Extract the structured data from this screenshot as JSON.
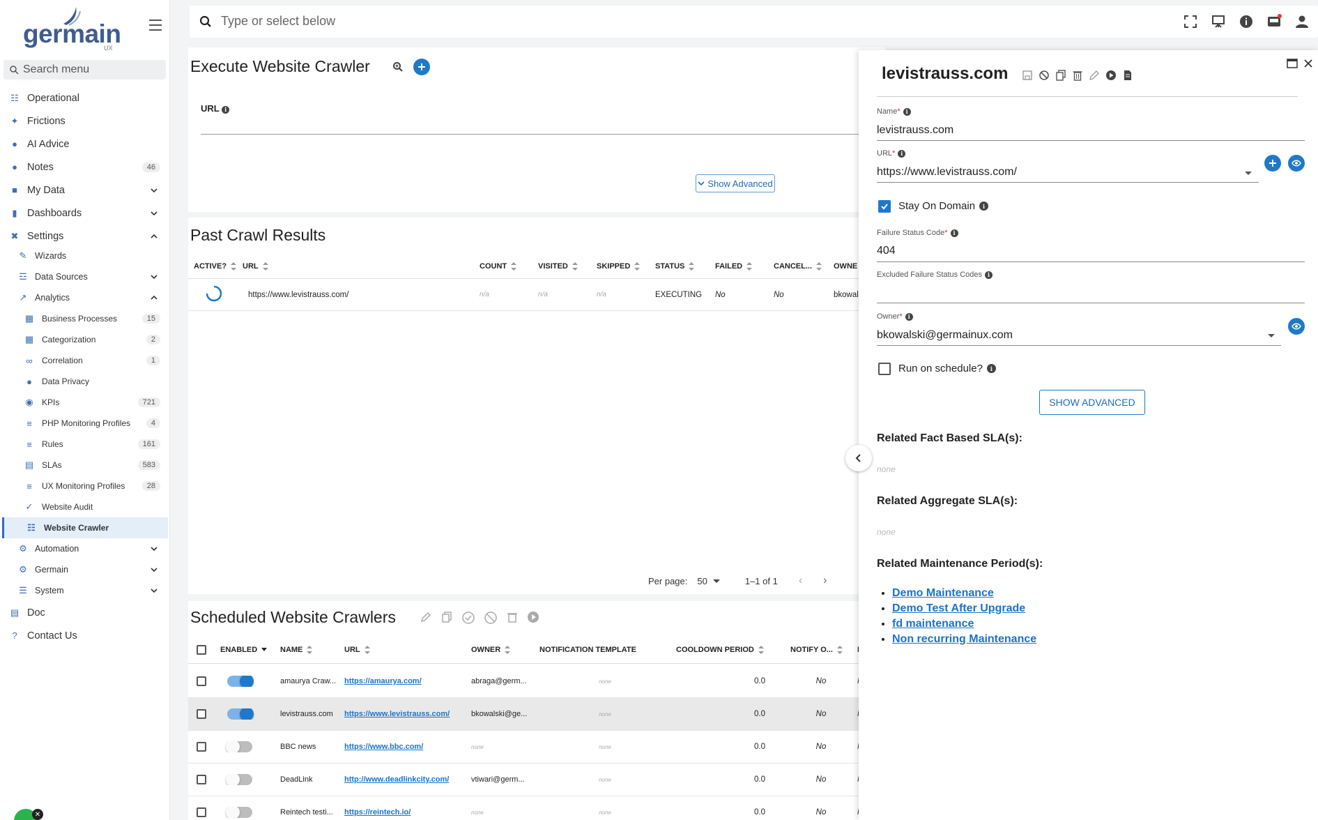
{
  "app": {
    "logo_text": "germain",
    "logo_sub": "UX"
  },
  "sidebar": {
    "search_placeholder": "Search menu",
    "items": [
      {
        "label": "Operational"
      },
      {
        "label": "Frictions"
      },
      {
        "label": "AI Advice"
      },
      {
        "label": "Notes",
        "badge": "46"
      },
      {
        "label": "My Data"
      },
      {
        "label": "Dashboards"
      },
      {
        "label": "Settings"
      },
      {
        "label": "Wizards"
      },
      {
        "label": "Data Sources"
      },
      {
        "label": "Analytics"
      },
      {
        "label": "Business Processes",
        "badge": "15"
      },
      {
        "label": "Categorization",
        "badge": "2"
      },
      {
        "label": "Correlation",
        "badge": "1"
      },
      {
        "label": "Data Privacy"
      },
      {
        "label": "KPIs",
        "badge": "721"
      },
      {
        "label": "PHP Monitoring Profiles",
        "badge": "4"
      },
      {
        "label": "Rules",
        "badge": "161"
      },
      {
        "label": "SLAs",
        "badge": "583"
      },
      {
        "label": "UX Monitoring Profiles",
        "badge": "28"
      },
      {
        "label": "Website Audit"
      },
      {
        "label": "Website Crawler"
      },
      {
        "label": "Automation"
      },
      {
        "label": "Germain"
      },
      {
        "label": "System"
      },
      {
        "label": "Doc"
      },
      {
        "label": "Contact Us"
      }
    ]
  },
  "topbar": {
    "search_placeholder": "Type or select below"
  },
  "execute": {
    "title": "Execute Website Crawler",
    "url_label": "URL",
    "show_advanced": "Show Advanced"
  },
  "past": {
    "title": "Past Crawl Results",
    "columns": [
      "ACTIVE?",
      "URL",
      "COUNT",
      "VISITED",
      "SKIPPED",
      "STATUS",
      "FAILED",
      "CANCEL...",
      "OWNE"
    ],
    "row": {
      "url": "https://www.levistrauss.com/",
      "count": "n/a",
      "visited": "n/a",
      "skipped": "n/a",
      "status": "EXECUTING",
      "failed": "No",
      "cancelled": "No",
      "owner": "bkowal"
    },
    "per_page_label": "Per page:",
    "per_page": "50",
    "range": "1–1 of 1"
  },
  "scheduled": {
    "title": "Scheduled Website Crawlers",
    "columns": [
      "ENABLED",
      "NAME",
      "URL",
      "OWNER",
      "NOTIFICATION TEMPLATE",
      "COOLDOWN PERIOD",
      "NOTIFY O...",
      "N"
    ],
    "rows": [
      {
        "enabled": true,
        "name": "amaurya Craw...",
        "url": "https://amaurya.com/",
        "owner": "abraga@germ...",
        "template": "none",
        "cooldown": "0.0",
        "notify": "No",
        "extra": "N"
      },
      {
        "enabled": true,
        "name": "levistrauss.com",
        "url": "https://www.levistrauss.com/",
        "owner": "bkowalski@ge...",
        "template": "none",
        "cooldown": "0.0",
        "notify": "No",
        "extra": "N"
      },
      {
        "enabled": false,
        "name": "BBC news",
        "url": "https://www.bbc.com/",
        "owner": "none",
        "template": "none",
        "cooldown": "0.0",
        "notify": "No",
        "extra": "N"
      },
      {
        "enabled": false,
        "name": "DeadLink",
        "url": "http://www.deadlinkcity.com/",
        "owner": "vtiwari@germ...",
        "template": "none",
        "cooldown": "0.0",
        "notify": "No",
        "extra": "N"
      },
      {
        "enabled": false,
        "name": "Reintech testi...",
        "url": "https://reintech.io/",
        "owner": "none",
        "template": "none",
        "cooldown": "0.0",
        "notify": "No",
        "extra": "N"
      }
    ]
  },
  "drawer": {
    "title": "levistrauss.com",
    "name_label": "Name",
    "name_value": "levistrauss.com",
    "url_label": "URL",
    "url_value": "https://www.levistrauss.com/",
    "stay_on_domain": "Stay On Domain",
    "stay_checked": true,
    "failure_label": "Failure Status Code",
    "failure_value": "404",
    "excluded_label": "Excluded Failure Status Codes",
    "excluded_value": "",
    "owner_label": "Owner",
    "owner_value": "bkowalski@germainux.com",
    "schedule_label": "Run on schedule?",
    "schedule_checked": false,
    "show_advanced": "SHOW ADVANCED",
    "fact_sla": "Related Fact Based SLA(s):",
    "fact_sla_value": "none",
    "agg_sla": "Related Aggregate SLA(s):",
    "agg_sla_value": "none",
    "maintenance": "Related Maintenance Period(s):",
    "maintenance_items": [
      "Demo Maintenance",
      "Demo Test After Upgrade",
      "fd maintenance",
      "Non recurring Maintenance"
    ]
  },
  "colors": {
    "accent": "#1f79c9",
    "link": "#1a73c9",
    "nav_icon": "#3f6fb5"
  }
}
